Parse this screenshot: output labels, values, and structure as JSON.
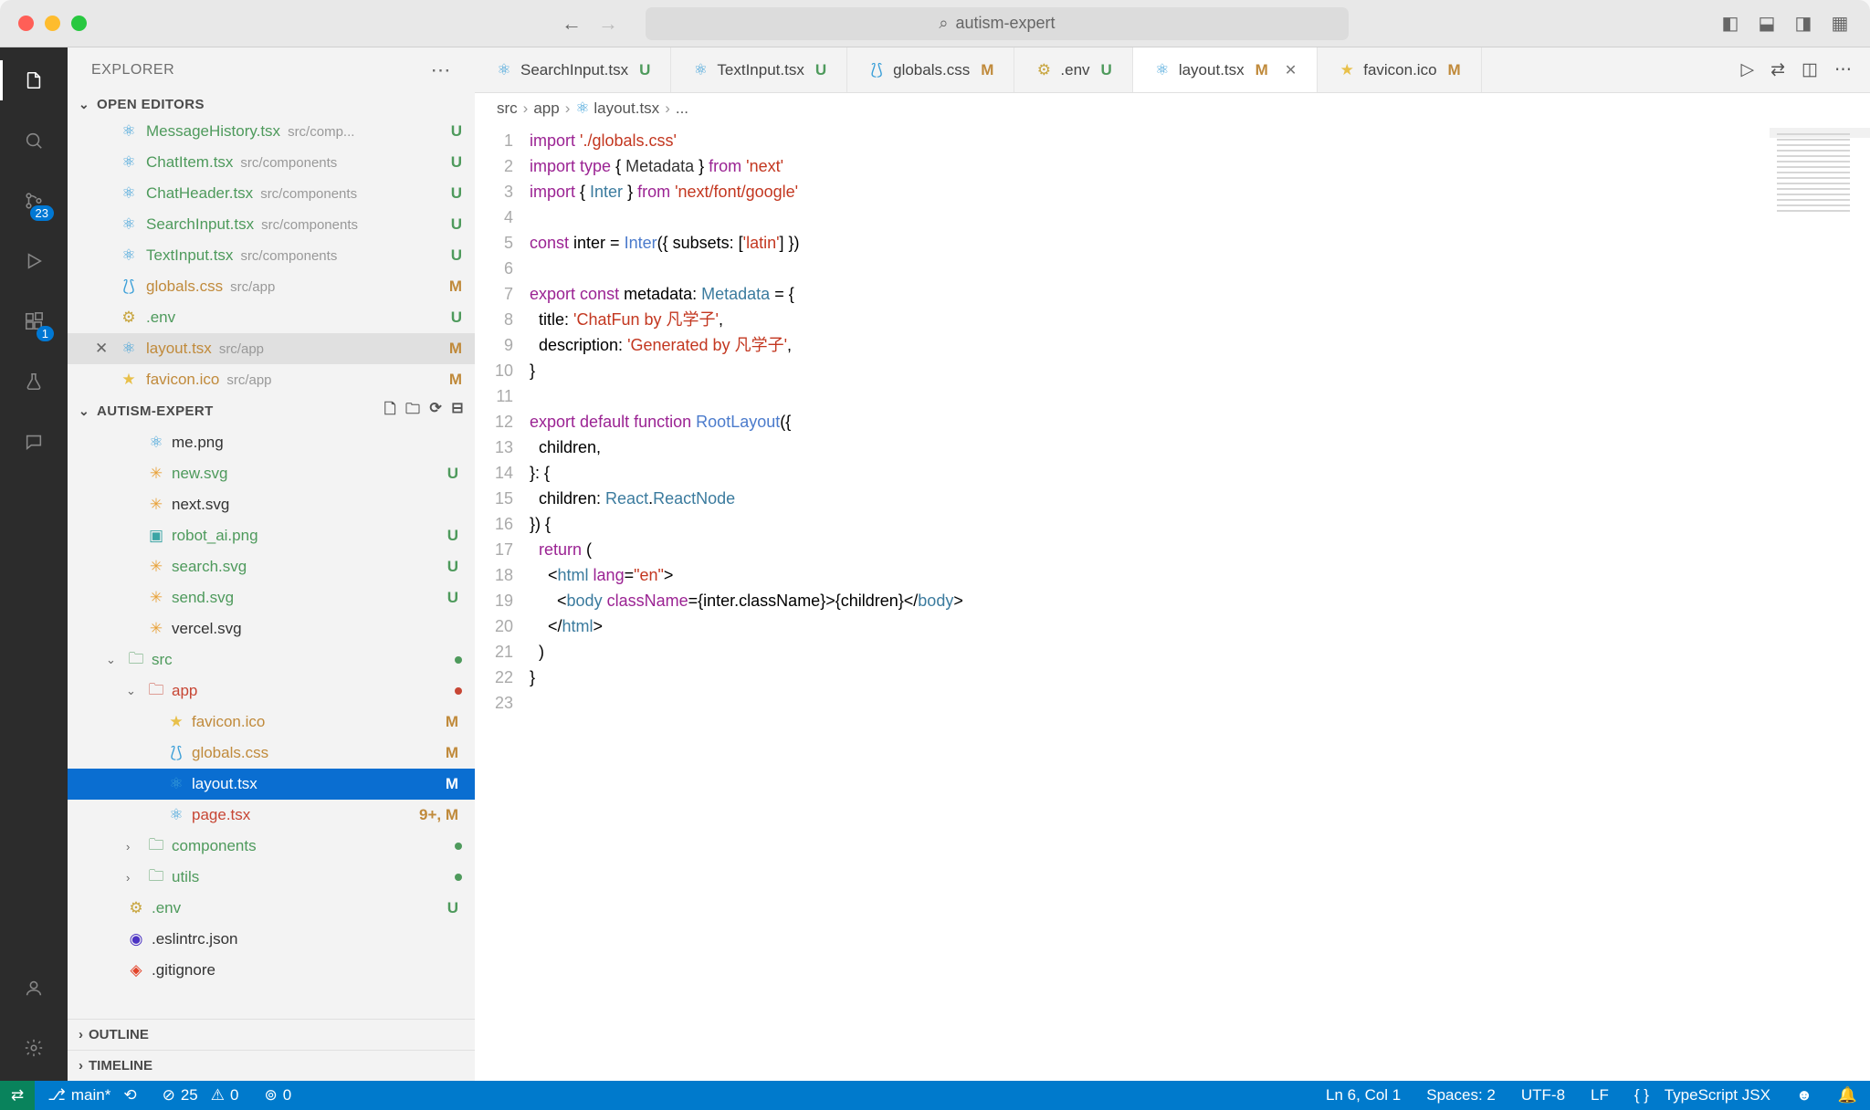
{
  "title_search": "autism-expert",
  "sidebar": {
    "title": "EXPLORER",
    "open_editors_label": "OPEN EDITORS",
    "project_label": "AUTISM-EXPERT",
    "outline_label": "OUTLINE",
    "timeline_label": "TIMELINE"
  },
  "open_editors": [
    {
      "name": "MessageHistory.tsx",
      "path": "src/comp...",
      "status": "U",
      "iconColor": "#3b9fd8"
    },
    {
      "name": "ChatItem.tsx",
      "path": "src/components",
      "status": "U",
      "iconColor": "#3b9fd8"
    },
    {
      "name": "ChatHeader.tsx",
      "path": "src/components",
      "status": "U",
      "iconColor": "#3b9fd8"
    },
    {
      "name": "SearchInput.tsx",
      "path": "src/components",
      "status": "U",
      "iconColor": "#3b9fd8"
    },
    {
      "name": "TextInput.tsx",
      "path": "src/components",
      "status": "U",
      "iconColor": "#3b9fd8"
    },
    {
      "name": "globals.css",
      "path": "src/app",
      "status": "M",
      "iconColor": "#3b9fd8",
      "css": true
    },
    {
      "name": ".env",
      "path": "",
      "status": "U",
      "iconColor": "#c8a53e",
      "env": true
    },
    {
      "name": "layout.tsx",
      "path": "src/app",
      "status": "M",
      "iconColor": "#3b9fd8",
      "active": true
    },
    {
      "name": "favicon.ico",
      "path": "src/app",
      "status": "M",
      "iconColor": "#e8c04a",
      "fav": true
    }
  ],
  "tree": [
    {
      "depth": 2,
      "name": "me.png",
      "status": "",
      "hidden": true
    },
    {
      "depth": 2,
      "name": "new.svg",
      "status": "U",
      "icon": "svg"
    },
    {
      "depth": 2,
      "name": "next.svg",
      "status": "",
      "icon": "svg"
    },
    {
      "depth": 2,
      "name": "robot_ai.png",
      "status": "U",
      "icon": "img"
    },
    {
      "depth": 2,
      "name": "search.svg",
      "status": "U",
      "icon": "svg"
    },
    {
      "depth": 2,
      "name": "send.svg",
      "status": "U",
      "icon": "svg"
    },
    {
      "depth": 2,
      "name": "vercel.svg",
      "status": "",
      "icon": "svg"
    },
    {
      "depth": 1,
      "name": "src",
      "folder": true,
      "open": true,
      "dot": true,
      "color": "#4e9a5c"
    },
    {
      "depth": 2,
      "name": "app",
      "folder": true,
      "open": true,
      "dot": true,
      "color": "#c74634"
    },
    {
      "depth": 3,
      "name": "favicon.ico",
      "status": "M",
      "icon": "fav"
    },
    {
      "depth": 3,
      "name": "globals.css",
      "status": "M",
      "icon": "css"
    },
    {
      "depth": 3,
      "name": "layout.tsx",
      "status": "M",
      "icon": "react",
      "selected": true
    },
    {
      "depth": 3,
      "name": "page.tsx",
      "status": "9+, M",
      "icon": "react",
      "red": true
    },
    {
      "depth": 2,
      "name": "components",
      "folder": true,
      "open": false,
      "dot": true,
      "color": "#4e9a5c"
    },
    {
      "depth": 2,
      "name": "utils",
      "folder": true,
      "open": false,
      "dot": true,
      "color": "#4e9a5c"
    },
    {
      "depth": 1,
      "name": ".env",
      "status": "U",
      "icon": "env"
    },
    {
      "depth": 1,
      "name": ".eslintrc.json",
      "status": "",
      "icon": "eslint"
    },
    {
      "depth": 1,
      "name": ".gitignore",
      "status": "",
      "icon": "git"
    }
  ],
  "tabs": [
    {
      "name": "SearchInput.tsx",
      "status": "U",
      "scolor": "#4e9a5c",
      "icon": "react"
    },
    {
      "name": "TextInput.tsx",
      "status": "U",
      "scolor": "#4e9a5c",
      "icon": "react"
    },
    {
      "name": "globals.css",
      "status": "M",
      "scolor": "#c08a3b",
      "icon": "css"
    },
    {
      "name": ".env",
      "status": "U",
      "scolor": "#4e9a5c",
      "icon": "env"
    },
    {
      "name": "layout.tsx",
      "status": "M",
      "scolor": "#c08a3b",
      "icon": "react",
      "active": true,
      "close": true
    },
    {
      "name": "favicon.ico",
      "status": "M",
      "scolor": "#c08a3b",
      "icon": "fav"
    }
  ],
  "breadcrumb": [
    "src",
    "app",
    "layout.tsx",
    "..."
  ],
  "code_lines": [
    [
      {
        "c": "tk-key",
        "t": "import"
      },
      {
        "t": " "
      },
      {
        "c": "tk-str",
        "t": "'./globals.css'"
      }
    ],
    [
      {
        "c": "tk-key",
        "t": "import"
      },
      {
        "t": " "
      },
      {
        "c": "tk-key",
        "t": "type"
      },
      {
        "t": " { "
      },
      {
        "c": "tk-id",
        "t": "Metadata"
      },
      {
        "t": " } "
      },
      {
        "c": "tk-key",
        "t": "from"
      },
      {
        "t": " "
      },
      {
        "c": "tk-str",
        "t": "'next'"
      }
    ],
    [
      {
        "c": "tk-key",
        "t": "import"
      },
      {
        "t": " { "
      },
      {
        "c": "tk-type",
        "t": "Inter"
      },
      {
        "t": " } "
      },
      {
        "c": "tk-key",
        "t": "from"
      },
      {
        "t": " "
      },
      {
        "c": "tk-str",
        "t": "'next/font/google'"
      }
    ],
    [],
    [
      {
        "c": "tk-key",
        "t": "const"
      },
      {
        "t": " inter = "
      },
      {
        "c": "tk-fn",
        "t": "Inter"
      },
      {
        "t": "({ subsets: ["
      },
      {
        "c": "tk-str",
        "t": "'latin'"
      },
      {
        "t": "] })"
      }
    ],
    [],
    [
      {
        "c": "tk-key",
        "t": "export"
      },
      {
        "t": " "
      },
      {
        "c": "tk-key",
        "t": "const"
      },
      {
        "t": " metadata: "
      },
      {
        "c": "tk-type",
        "t": "Metadata"
      },
      {
        "t": " = {"
      }
    ],
    [
      {
        "t": "  title: "
      },
      {
        "c": "tk-str",
        "t": "'ChatFun by 凡学子'"
      },
      {
        "t": ","
      }
    ],
    [
      {
        "t": "  description: "
      },
      {
        "c": "tk-str",
        "t": "'Generated by 凡学子'"
      },
      {
        "t": ","
      }
    ],
    [
      {
        "t": "}"
      }
    ],
    [],
    [
      {
        "c": "tk-key",
        "t": "export"
      },
      {
        "t": " "
      },
      {
        "c": "tk-key",
        "t": "default"
      },
      {
        "t": " "
      },
      {
        "c": "tk-key",
        "t": "function"
      },
      {
        "t": " "
      },
      {
        "c": "tk-fn",
        "t": "RootLayout"
      },
      {
        "t": "({"
      }
    ],
    [
      {
        "t": "  children,"
      }
    ],
    [
      {
        "t": "}: {"
      }
    ],
    [
      {
        "t": "  children: "
      },
      {
        "c": "tk-type",
        "t": "React"
      },
      {
        "t": "."
      },
      {
        "c": "tk-type",
        "t": "ReactNode"
      }
    ],
    [
      {
        "t": "}) {"
      }
    ],
    [
      {
        "t": "  "
      },
      {
        "c": "tk-key",
        "t": "return"
      },
      {
        "t": " ("
      }
    ],
    [
      {
        "t": "    <"
      },
      {
        "c": "tk-tag",
        "t": "html"
      },
      {
        "t": " "
      },
      {
        "c": "tk-attr",
        "t": "lang"
      },
      {
        "t": "="
      },
      {
        "c": "tk-str",
        "t": "\"en\""
      },
      {
        "t": ">"
      }
    ],
    [
      {
        "t": "      <"
      },
      {
        "c": "tk-tag",
        "t": "body"
      },
      {
        "t": " "
      },
      {
        "c": "tk-attr",
        "t": "className"
      },
      {
        "t": "={inter.className}>{children}</"
      },
      {
        "c": "tk-tag",
        "t": "body"
      },
      {
        "t": ">"
      }
    ],
    [
      {
        "t": "    </"
      },
      {
        "c": "tk-tag",
        "t": "html"
      },
      {
        "t": ">"
      }
    ],
    [
      {
        "t": "  )"
      }
    ],
    [
      {
        "t": "}"
      }
    ],
    []
  ],
  "activity_badges": {
    "scm": "23",
    "ext": "1"
  },
  "statusbar": {
    "branch": "main*",
    "errors": "25",
    "warnings": "0",
    "radio": "0",
    "cursor": "Ln 6, Col 1",
    "spaces": "Spaces: 2",
    "encoding": "UTF-8",
    "eol": "LF",
    "lang": "TypeScript JSX",
    "port_icon": "⎘"
  }
}
